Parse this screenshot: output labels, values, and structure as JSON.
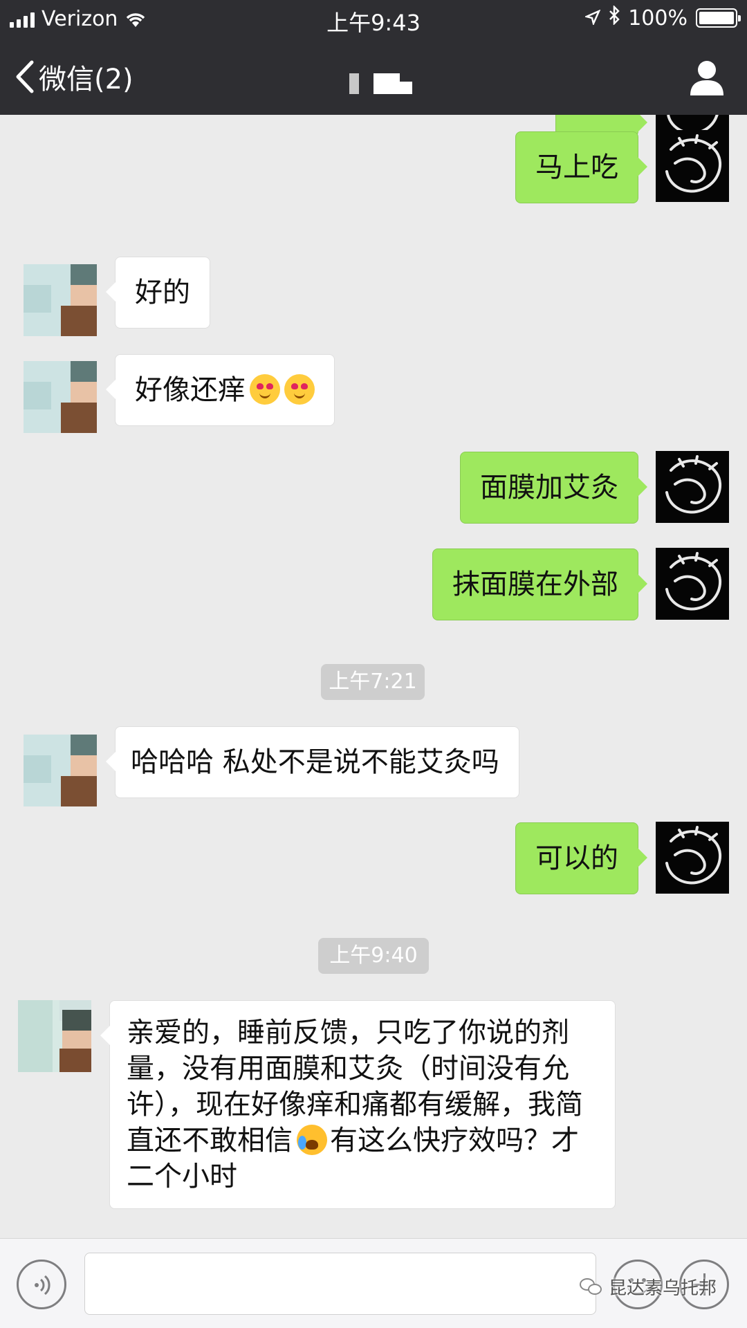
{
  "status_bar": {
    "carrier": "Verizon",
    "time": "上午9:43",
    "battery": "100%"
  },
  "nav": {
    "back_label": "微信(2)",
    "icons": {
      "back": "chevron-left-icon",
      "profile": "person-icon"
    }
  },
  "messages": [
    {
      "side": "me",
      "text": "马上吃"
    },
    {
      "side": "them",
      "text": "好的"
    },
    {
      "side": "them",
      "text": "好像还痒",
      "emoji_count": 2
    },
    {
      "side": "me",
      "text": "面膜加艾灸"
    },
    {
      "side": "me",
      "text": "抹面膜在外部"
    },
    {
      "type": "time",
      "text": "上午7:21"
    },
    {
      "side": "them",
      "text": "哈哈哈 私处不是说不能艾灸吗"
    },
    {
      "side": "me",
      "text": "可以的"
    },
    {
      "type": "time",
      "text": "上午9:40"
    },
    {
      "side": "them",
      "text_before_emoji": "亲爱的，睡前反馈，只吃了你说的剂量，没有用面膜和艾灸（时间没有允许），现在好像痒和痛都有缓解，我简直还不敢相信",
      "text_after_emoji": "有这么快疗效吗？才二个小时"
    }
  ],
  "watermark": "昆达素乌托邦",
  "colors": {
    "header": "#2e2e32",
    "chat_bg": "#ebebeb",
    "my_bubble": "#9ee85e",
    "their_bubble": "#ffffff",
    "time_pill": "#cecece"
  }
}
